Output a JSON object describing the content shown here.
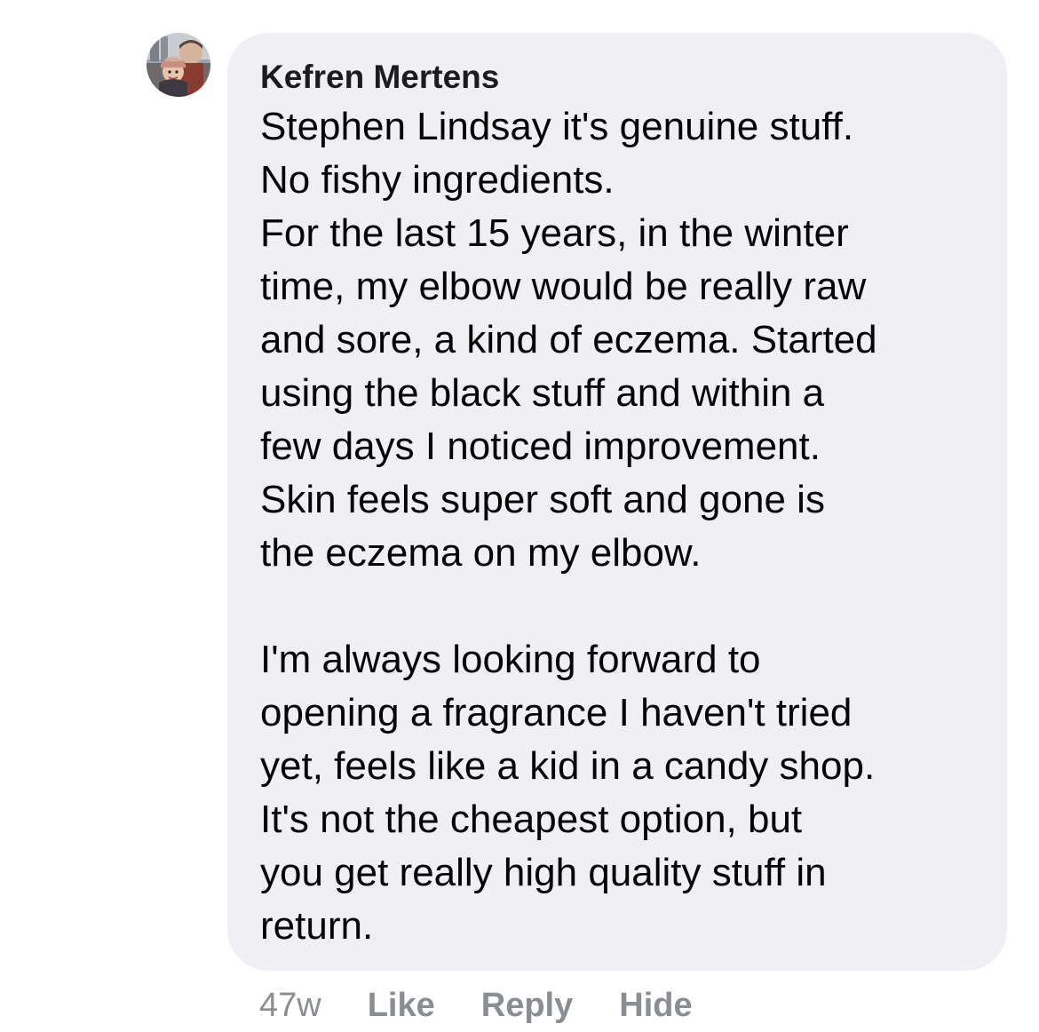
{
  "comment": {
    "author": "Kefren Mertens",
    "avatar_icon": "profile-photo-couple",
    "lines": [
      "Stephen Lindsay it's genuine stuff.",
      "No fishy ingredients.",
      "For the last 15 years, in the winter",
      "time, my elbow would be really raw",
      "and sore, a kind of eczema. Started",
      "using the black stuff and within a",
      "few days I noticed improvement.",
      "Skin feels super soft and gone is",
      "the eczema on my elbow.",
      "",
      "I'm always looking forward to",
      "opening a fragrance I haven't tried",
      "yet, feels like a kid in a candy shop.",
      "It's not the cheapest option, but",
      "you get really high quality stuff in",
      "return."
    ],
    "timestamp": "47w",
    "actions": {
      "like": "Like",
      "reply": "Reply",
      "hide": "Hide"
    }
  },
  "colors": {
    "bubble_background": "#f0f0f4",
    "text": "#050505",
    "muted": "#8a8d91"
  }
}
